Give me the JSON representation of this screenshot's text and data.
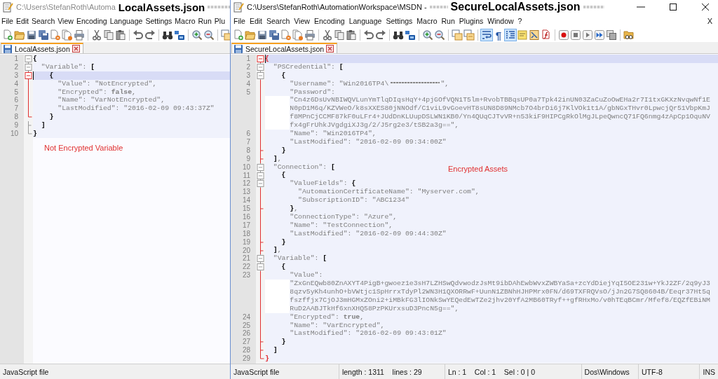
{
  "windows": [
    {
      "title": {
        "path": "C:\\Users\\StefanRoth\\Automa",
        "redacted": true,
        "annotation": "LocalAssets.json",
        "active": false
      },
      "menu": [
        "File",
        "Edit",
        "Search",
        "View",
        "Encoding",
        "Language",
        "Settings",
        "Macro",
        "Run",
        "Plu"
      ],
      "toolbar": [
        {
          "kind": "new",
          "pressed": false
        },
        {
          "kind": "open",
          "pressed": false
        },
        {
          "kind": "save",
          "pressed": false
        },
        {
          "kind": "saveall",
          "pressed": false
        },
        {
          "kind": "close",
          "pressed": false
        },
        {
          "kind": "closeall",
          "pressed": false
        },
        {
          "kind": "print",
          "pressed": false
        },
        {
          "kind": "separator"
        },
        {
          "kind": "cut",
          "pressed": false
        },
        {
          "kind": "copy",
          "pressed": false
        },
        {
          "kind": "paste",
          "pressed": false
        },
        {
          "kind": "separator"
        },
        {
          "kind": "undo",
          "pressed": false
        },
        {
          "kind": "redo",
          "pressed": false
        },
        {
          "kind": "separator"
        },
        {
          "kind": "find",
          "pressed": false
        },
        {
          "kind": "replace",
          "pressed": false
        },
        {
          "kind": "separator"
        },
        {
          "kind": "zoomin",
          "pressed": false
        },
        {
          "kind": "zoomout",
          "pressed": false
        },
        {
          "kind": "separator"
        },
        {
          "kind": "syncv",
          "pressed": false
        }
      ],
      "tabs": [
        {
          "label": "LocalAssets.json",
          "selected": true
        }
      ],
      "lines": [
        {
          "number": "1",
          "parts": [
            "{"
          ],
          "fold": {
            "kind": "box",
            "active": false
          },
          "current": false,
          "matched": false
        },
        {
          "number": "2",
          "parts": [
            "  \"Variable\": ["
          ],
          "fold": {
            "kind": "box",
            "active": false
          },
          "current": false,
          "matched": false
        },
        {
          "number": "3",
          "parts": [
            "    {"
          ],
          "fold": {
            "kind": "box",
            "active": true
          },
          "current": true,
          "matched": false
        },
        {
          "number": "4",
          "parts": [
            "      \"Value\": \"NotEncrypted\","
          ],
          "fold": {
            "kind": "line",
            "active": true
          },
          "current": false,
          "matched": false
        },
        {
          "number": "5",
          "parts": [
            "      \"Encrypted\": **false**,"
          ],
          "fold": {
            "kind": "line",
            "active": true
          },
          "current": false,
          "matched": false
        },
        {
          "number": "6",
          "parts": [
            "      \"Name\": \"VarNotEncrypted\","
          ],
          "fold": {
            "kind": "line",
            "active": true
          },
          "current": false,
          "matched": false
        },
        {
          "number": "7",
          "parts": [
            "      \"LastModified\": \"2016-02-09 09:43:37Z\""
          ],
          "fold": {
            "kind": "line",
            "active": true
          },
          "current": false,
          "matched": false
        },
        {
          "number": "8",
          "parts": [
            "    }"
          ],
          "fold": {
            "kind": "end",
            "active": true
          },
          "current": false,
          "matched": false
        },
        {
          "number": "9",
          "parts": [
            "  ]"
          ],
          "fold": {
            "kind": "tick",
            "active": false
          },
          "current": false,
          "matched": false
        },
        {
          "number": "10",
          "parts": [
            "}"
          ],
          "fold": {
            "kind": "end",
            "active": false
          },
          "current": false,
          "matched": false
        }
      ],
      "note": "Not Encrypted Variable",
      "status": [
        "JavaScript file"
      ]
    },
    {
      "title": {
        "path": "C:\\Users\\StefanRoth\\AutomationWorkspace\\MSDN -",
        "redacted": true,
        "annotation": "SecureLocalAssets.json",
        "active": true
      },
      "window_controls": true,
      "menu": [
        "File",
        "Edit",
        "Search",
        "View",
        "Encoding",
        "Language",
        "Settings",
        "Macro",
        "Run",
        "Plugins",
        "Window",
        "?"
      ],
      "menu_close": "X",
      "toolbar": [
        {
          "kind": "new",
          "pressed": false
        },
        {
          "kind": "open",
          "pressed": false
        },
        {
          "kind": "save",
          "pressed": false
        },
        {
          "kind": "saveall",
          "pressed": false
        },
        {
          "kind": "close",
          "pressed": false
        },
        {
          "kind": "closeall",
          "pressed": false
        },
        {
          "kind": "print",
          "pressed": false
        },
        {
          "kind": "separator"
        },
        {
          "kind": "cut",
          "pressed": false
        },
        {
          "kind": "copy",
          "pressed": false
        },
        {
          "kind": "paste",
          "pressed": false
        },
        {
          "kind": "separator"
        },
        {
          "kind": "undo",
          "pressed": false
        },
        {
          "kind": "redo",
          "pressed": false
        },
        {
          "kind": "separator"
        },
        {
          "kind": "find",
          "pressed": false
        },
        {
          "kind": "replace",
          "pressed": false
        },
        {
          "kind": "separator"
        },
        {
          "kind": "zoomin",
          "pressed": false
        },
        {
          "kind": "zoomout",
          "pressed": false
        },
        {
          "kind": "separator"
        },
        {
          "kind": "syncv",
          "pressed": false
        },
        {
          "kind": "synch",
          "pressed": false
        },
        {
          "kind": "separator"
        },
        {
          "kind": "wrap",
          "pressed": true
        },
        {
          "kind": "allchars",
          "glyph": "¶",
          "pressed": false
        },
        {
          "kind": "indentguide",
          "pressed": true
        },
        {
          "kind": "udl",
          "pressed": false
        },
        {
          "kind": "docmap",
          "pressed": false
        },
        {
          "kind": "funclist",
          "pressed": false
        },
        {
          "kind": "separator"
        },
        {
          "kind": "record",
          "pressed": false
        },
        {
          "kind": "stop",
          "pressed": false
        },
        {
          "kind": "play",
          "pressed": false
        },
        {
          "kind": "playmulti",
          "pressed": false
        },
        {
          "kind": "savemacro",
          "pressed": false
        },
        {
          "kind": "separator"
        },
        {
          "kind": "monitor",
          "pressed": false
        }
      ],
      "tabs": [
        {
          "label": "SecureLocalAssets.json",
          "selected": true
        }
      ],
      "lines": [
        {
          "number": "1",
          "parts": [
            "{"
          ],
          "fold": {
            "kind": "box",
            "active": true
          },
          "current": true,
          "matched": true
        },
        {
          "number": "2",
          "parts": [
            "  \"PSCredential\": ["
          ],
          "fold": {
            "kind": "box",
            "active": false
          },
          "current": false,
          "matched": false
        },
        {
          "number": "3",
          "parts": [
            "    {"
          ],
          "fold": {
            "kind": "box",
            "active": false
          },
          "current": false,
          "matched": false
        },
        {
          "number": "4",
          "parts": [
            "      \"Username\": \"Win2016TP4\\"
          ],
          "redacted": true,
          "after": "\",",
          "fold": {
            "kind": "line",
            "active": true
          },
          "current": false,
          "matched": false
        },
        {
          "number": "5",
          "parts": [
            "      \"Password\":",
            "\"Cn4z6DsUvNBIWQVLunYmTlqDIqsHqY+4pjGOfVQN1T5lm+RvobTBBqsUP0a7Tpk42inUN03ZaCuZoOwEHa2r7I1txGKXzNvqwNf1E",
            "N0pD1M6q/KZVWeO/k8sXXES80jNNOdf/C1viL9vGoevHT8sUN8D89NMcb7O4brDi6j7KlVOk1t1A/gbNGxTHvr0LpwcjQr51VbpKmJ",
            "f8MPnCjCCMF87kF0uLFr4+JUdDnKLUupDSLWN1KB0/Yn4QUqCJTvVR+n53kiF9HIPCgRkOlMgJLpeQwncQ71FQ6nmg4zApCp1OquNV",
            "fx4gFrUhkJVgdgiXJ3g/2/J5rg2e3/tSB2a3g==\","
          ],
          "fold": {
            "kind": "line",
            "active": true
          },
          "current": false,
          "matched": false
        },
        {
          "number": "6",
          "parts": [
            "      \"Name\": \"Win2016TP4\","
          ],
          "fold": {
            "kind": "line",
            "active": true
          },
          "current": false,
          "matched": false
        },
        {
          "number": "7",
          "parts": [
            "      \"LastModified\": \"2016-02-09 09:34:00Z\""
          ],
          "fold": {
            "kind": "line",
            "active": true
          },
          "current": false,
          "matched": false
        },
        {
          "number": "8",
          "parts": [
            "    }"
          ],
          "fold": {
            "kind": "tick",
            "active": true
          },
          "current": false,
          "matched": false
        },
        {
          "number": "9",
          "parts": [
            "  ],"
          ],
          "fold": {
            "kind": "tick",
            "active": true
          },
          "current": false,
          "matched": false
        },
        {
          "number": "10",
          "parts": [
            "  \"Connection\": ["
          ],
          "fold": {
            "kind": "box",
            "active": false
          },
          "current": false,
          "matched": false
        },
        {
          "number": "11",
          "parts": [
            "    {"
          ],
          "fold": {
            "kind": "box",
            "active": false
          },
          "current": false,
          "matched": false
        },
        {
          "number": "12",
          "parts": [
            "      \"ValueFields\": {"
          ],
          "fold": {
            "kind": "box",
            "active": false
          },
          "current": false,
          "matched": false
        },
        {
          "number": "13",
          "parts": [
            "        \"AutomationCertificateName\": \"Myserver.com\","
          ],
          "fold": {
            "kind": "line",
            "active": true
          },
          "current": false,
          "matched": false
        },
        {
          "number": "14",
          "parts": [
            "        \"SubscriptionID\": \"ABC1234\""
          ],
          "fold": {
            "kind": "line",
            "active": true
          },
          "current": false,
          "matched": false
        },
        {
          "number": "15",
          "parts": [
            "      },"
          ],
          "fold": {
            "kind": "tick",
            "active": true
          },
          "current": false,
          "matched": false
        },
        {
          "number": "16",
          "parts": [
            "      \"ConnectionType\": \"Azure\","
          ],
          "fold": {
            "kind": "line",
            "active": true
          },
          "current": false,
          "matched": false
        },
        {
          "number": "17",
          "parts": [
            "      \"Name\": \"TestConnection\","
          ],
          "fold": {
            "kind": "line",
            "active": true
          },
          "current": false,
          "matched": false
        },
        {
          "number": "18",
          "parts": [
            "      \"LastModified\": \"2016-02-09 09:44:30Z\""
          ],
          "fold": {
            "kind": "line",
            "active": true
          },
          "current": false,
          "matched": false
        },
        {
          "number": "19",
          "parts": [
            "    }"
          ],
          "fold": {
            "kind": "tick",
            "active": true
          },
          "current": false,
          "matched": false
        },
        {
          "number": "20",
          "parts": [
            "  ],"
          ],
          "fold": {
            "kind": "tick",
            "active": true
          },
          "current": false,
          "matched": false
        },
        {
          "number": "21",
          "parts": [
            "  \"Variable\": ["
          ],
          "fold": {
            "kind": "box",
            "active": false
          },
          "current": false,
          "matched": false
        },
        {
          "number": "22",
          "parts": [
            "    {"
          ],
          "fold": {
            "kind": "box",
            "active": false
          },
          "current": false,
          "matched": false
        },
        {
          "number": "23",
          "parts": [
            "      \"Value\":",
            "\"ZxGnEQwb80ZnAXYT4PigB+gwoez1e3sH7LZHSwQdvwodzJsMt9ibDAhEwbWvxZWBYaSa+zcYdDiejYqI5OE231w+YkJ2ZF/2q9yJ3",
            "8qzv5yKh4unhO+bVWtjc1SpHrrxTdyPl2WN3H1QXORRwF+UunN1ZBNhHJHPMrx0FN/d69TXFRQVsO/jJn2G7SQ8604B/Eeqr37Ht5q",
            "fszffjx7CjOJ3mHGMxZOni2+iMBkFG3lIONkSwYEQedEwTZe2jhv20YfA2MB60TRyf++gfRHxMo/v0hTEqBCmr/Mfef8/EQZfEBiNM",
            "RuD2AABJTkHf6xnXHQ58PzPKUrxsuD3PncN5g==\","
          ],
          "fold": {
            "kind": "line",
            "active": true
          },
          "current": false,
          "matched": false
        },
        {
          "number": "24",
          "parts": [
            "      \"Encrypted\": **true**,"
          ],
          "fold": {
            "kind": "line",
            "active": true
          },
          "current": false,
          "matched": false
        },
        {
          "number": "25",
          "parts": [
            "      \"Name\": \"VarEncrypted\","
          ],
          "fold": {
            "kind": "line",
            "active": true
          },
          "current": false,
          "matched": false
        },
        {
          "number": "26",
          "parts": [
            "      \"LastModified\": \"2016-02-09 09:43:01Z\""
          ],
          "fold": {
            "kind": "line",
            "active": true
          },
          "current": false,
          "matched": false
        },
        {
          "number": "27",
          "parts": [
            "    }"
          ],
          "fold": {
            "kind": "tick",
            "active": true
          },
          "current": false,
          "matched": false
        },
        {
          "number": "28",
          "parts": [
            "  ]"
          ],
          "fold": {
            "kind": "tick",
            "active": true
          },
          "current": false,
          "matched": false
        },
        {
          "number": "29",
          "parts": [
            "}"
          ],
          "fold": {
            "kind": "end",
            "active": true
          },
          "current": false,
          "matched": true
        }
      ],
      "note": "Encrypted Assets",
      "status": [
        "JavaScript file",
        "length : 1311    lines : 29",
        "Ln : 1    Col : 1    Sel : 0 | 0",
        "Dos\\Windows",
        "UTF-8",
        "INS"
      ]
    }
  ]
}
